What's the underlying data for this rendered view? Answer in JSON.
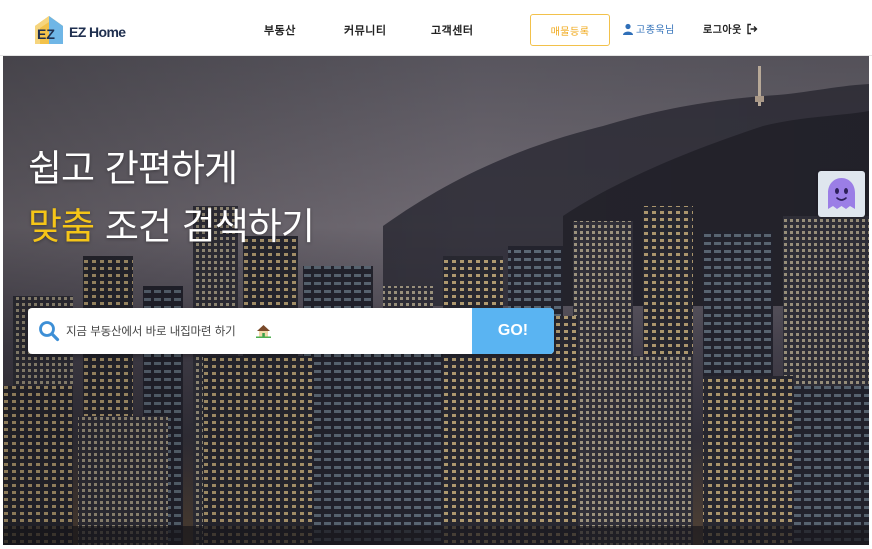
{
  "header": {
    "logo_text": "EZ Home",
    "logo_mark": "EZ",
    "nav": [
      "부동산",
      "커뮤니티",
      "고객센터"
    ],
    "listing_button": "매물등록",
    "user_label": "고종욱님",
    "logout_label": "로그아웃"
  },
  "hero": {
    "title_line1": "쉽고 간편하게",
    "title_accent": "맞춤",
    "title_line2_rest": " 조건 검색하기"
  },
  "search": {
    "placeholder": "지금 부동산에서 바로 내집마련 하기",
    "go_label": "GO!"
  },
  "icons": {
    "search": "search-icon",
    "house": "house-emoji-icon",
    "user": "user-icon",
    "logout": "logout-icon",
    "chatbot": "chatbot-ghost-icon"
  },
  "colors": {
    "accent_yellow": "#f5c518",
    "go_button": "#5ab4f2",
    "user_link": "#2f6fb8",
    "listing_border": "#f2c14b"
  }
}
